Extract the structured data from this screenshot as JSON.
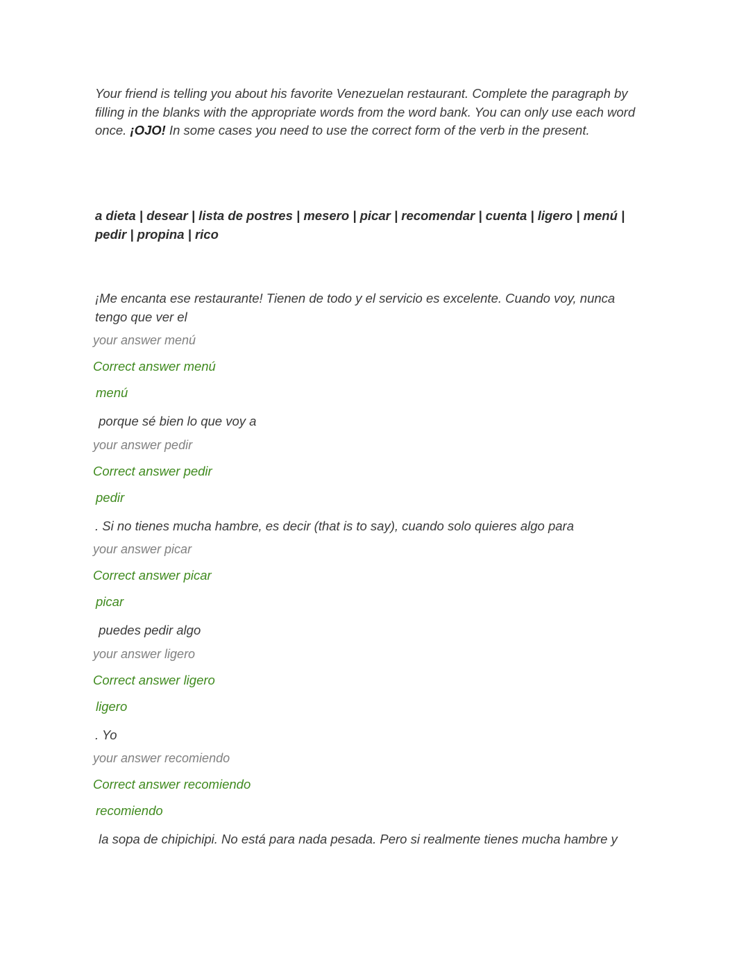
{
  "page": {
    "background_color": "#ffffff",
    "text_color": "#3a3a3a",
    "muted_color": "#808080",
    "correct_color": "#3f8a1e"
  },
  "instructions": {
    "part1": "Your friend is telling you about his favorite Venezuelan restaurant. Complete the paragraph by filling in the blanks with the appropriate words from the word bank. You can only use each word once. ",
    "emphasis": "¡OJO!",
    "part2": " In some cases you need to use the correct form of the verb in the present."
  },
  "word_bank": {
    "line1": "a dieta | desear | lista de postres | mesero | picar | recomendar | cuenta | ligero |",
    "line2": "menú | pedir | propina | rico",
    "words": [
      "a dieta",
      "desear",
      "lista de postres",
      "mesero",
      "picar",
      "recomendar",
      "cuenta",
      "ligero",
      "menú",
      "pedir",
      "propina",
      "rico"
    ]
  },
  "exercise": {
    "blocks": [
      {
        "sentence": "¡Me encanta ese restaurante! Tienen de todo y el servicio es excelente. Cuando voy, nunca tengo que ver el",
        "your_answer_label": "your answer menú",
        "correct_answer_label": "Correct answer menú",
        "answer_word": "menú"
      },
      {
        "sentence": " porque sé bien lo que voy a",
        "your_answer_label": "your answer pedir",
        "correct_answer_label": "Correct answer pedir",
        "answer_word": "pedir"
      },
      {
        "sentence": ". Si no tienes mucha hambre, es decir (that is to say), cuando solo quieres algo para",
        "your_answer_label": "your answer picar",
        "correct_answer_label": "Correct answer picar",
        "answer_word": "picar"
      },
      {
        "sentence": " puedes pedir algo",
        "your_answer_label": "your answer ligero",
        "correct_answer_label": "Correct answer ligero",
        "answer_word": "ligero"
      },
      {
        "sentence": ". Yo",
        "your_answer_label": "your answer recomiendo",
        "correct_answer_label": "Correct answer recomiendo",
        "answer_word": "recomiendo"
      }
    ],
    "closing_sentence": " la sopa de chipichipi. No está para nada pesada. Pero si realmente tienes mucha hambre y"
  }
}
